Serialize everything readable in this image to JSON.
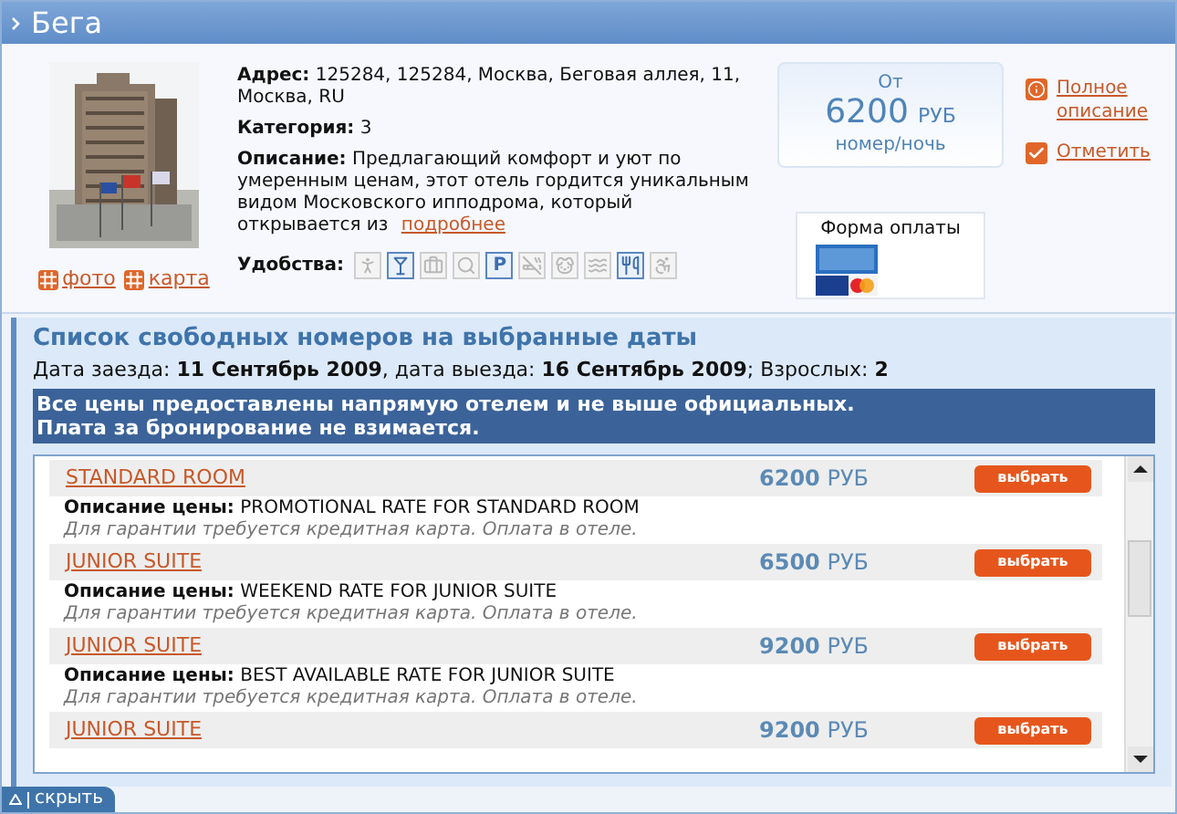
{
  "window": {
    "title": "Бега"
  },
  "hotel": {
    "photo_link": "фото",
    "map_link": "карта",
    "address": "**Адрес:** 125284, 125284, Москва, Беговая аллея, 11, Москва, RU",
    "category": "**Категория:** 3",
    "description": "**Описание:** Предлагающий комфорт и уют по умеренным ценам, этот отель гордится уникальным видом Московского ипподрома, который открывается из",
    "more_link": "подробнее",
    "amenities_label": "Удобства:",
    "amenities": [
      {
        "available": false
      },
      {
        "available": true
      },
      {
        "available": false
      },
      {
        "available": false
      },
      {
        "available": true,
        "label": "P"
      },
      {
        "available": false
      },
      {
        "available": false
      },
      {
        "available": false
      },
      {
        "available": true
      },
      {
        "available": false
      }
    ],
    "price": {
      "from": "От",
      "amount": "6200",
      "currency": "РУБ",
      "unit": "номер/ночь"
    },
    "payment_title": "Форма оплаты",
    "links": [
      {
        "kind": "info",
        "text": "Полное описание"
      },
      {
        "kind": "check",
        "text": "Отметить"
      }
    ]
  },
  "rooms": {
    "title": "Список свободных номеров на выбранные даты",
    "dates": "Дата заезда: **11 Сентябрь 2009**, дата выезда: **16 Сентябрь 2009**; Взрослых: **2**",
    "notice": [
      "Все цены предоставлены напрямую отелем и не выше официальных.",
      "Плата за бронирование не взимается."
    ],
    "list": [
      {
        "name": "STANDARD ROOM",
        "amount": "6200",
        "currency": "РУБ",
        "button": "выбрать",
        "rate": "**Описание цены:** PROMOTIONAL RATE FOR STANDARD ROOM",
        "note": "Для гарантии требуется кредитная карта. Оплата в отеле."
      },
      {
        "name": "JUNIOR SUITE",
        "amount": "6500",
        "currency": "РУБ",
        "button": "выбрать",
        "rate": "**Описание цены:** WEEKEND RATE FOR JUNIOR SUITE",
        "note": "Для гарантии требуется кредитная карта. Оплата в отеле."
      },
      {
        "name": "JUNIOR SUITE",
        "amount": "9200",
        "currency": "РУБ",
        "button": "выбрать",
        "rate": "**Описание цены:** BEST AVAILABLE RATE FOR JUNIOR SUITE",
        "note": "Для гарантии требуется кредитная карта. Оплата в отеле."
      },
      {
        "name": "JUNIOR SUITE",
        "amount": "9200",
        "currency": "РУБ",
        "button": "выбрать"
      }
    ]
  },
  "footer": {
    "hide": "скрыть"
  }
}
